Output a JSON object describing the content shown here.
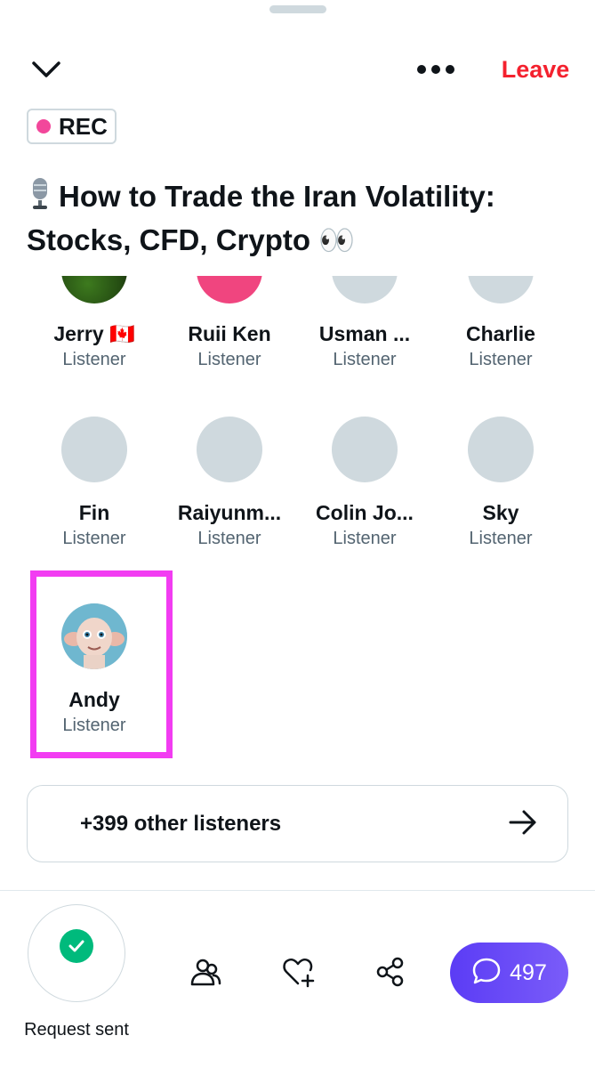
{
  "header": {
    "leave_label": "Leave"
  },
  "rec_badge": {
    "label": "REC"
  },
  "space": {
    "title_line1": "How to Trade the Iran Volatility:",
    "title_line2": "Stocks, CFD, Crypto 👀"
  },
  "participants_row1": [
    {
      "name": "Jerry 🇨🇦",
      "role": "Listener"
    },
    {
      "name": "Ruii Ken",
      "role": "Listener"
    },
    {
      "name": "Usman ...",
      "role": "Listener"
    },
    {
      "name": "Charlie",
      "role": "Listener"
    }
  ],
  "participants_row2": [
    {
      "name": "Fin",
      "role": "Listener"
    },
    {
      "name": "Raiyunm...",
      "role": "Listener"
    },
    {
      "name": "Colin Jo...",
      "role": "Listener"
    },
    {
      "name": "Sky",
      "role": "Listener"
    }
  ],
  "participants_row3": [
    {
      "name": "Andy",
      "role": "Listener"
    }
  ],
  "other_listeners": {
    "label": "+399 other listeners"
  },
  "bottom_bar": {
    "request_label": "Request sent",
    "chat_count": "497"
  },
  "colors": {
    "leave": "#f4212e",
    "rec_dot": "#f2479b",
    "highlight": "#f23cf2",
    "check": "#00ba7c",
    "chat_gradient_start": "#5b3cf5",
    "chat_gradient_end": "#7a5cf9"
  },
  "icons": {
    "chevron": "chevron-down-icon",
    "more": "more-dots-icon",
    "microphone": "microphone-icon",
    "arrow": "arrow-right-icon",
    "check": "check-icon",
    "people": "people-icon",
    "heart": "heart-plus-icon",
    "share": "share-icon",
    "chat": "chat-bubble-icon"
  }
}
